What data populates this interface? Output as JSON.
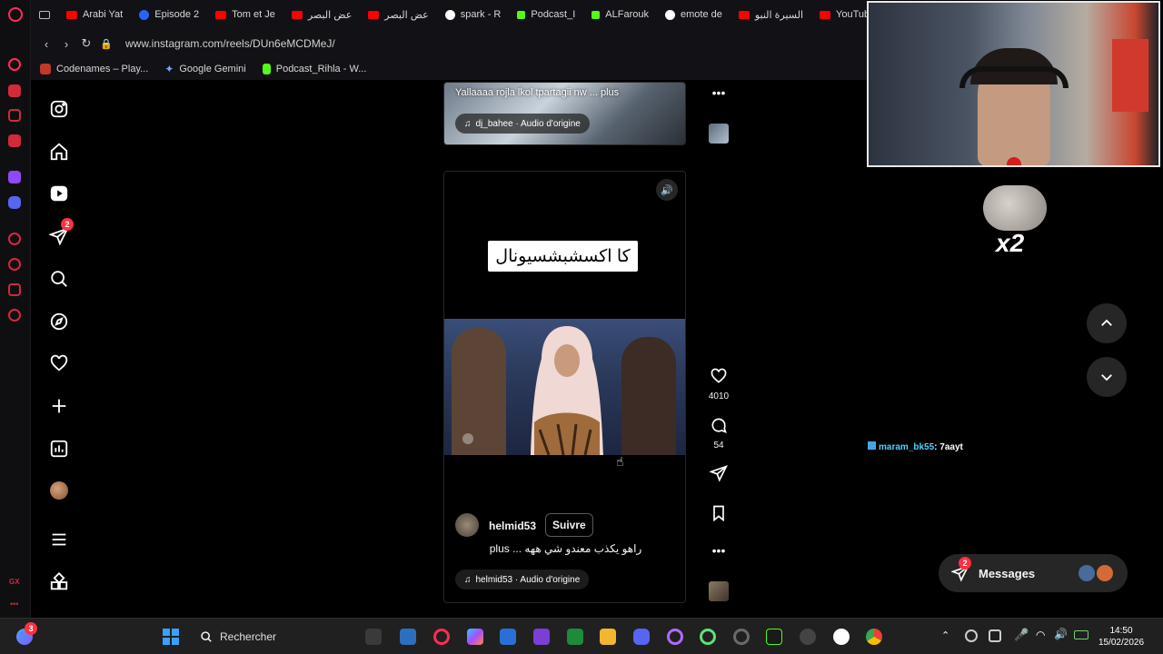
{
  "browser": {
    "tabs": [
      {
        "label": "",
        "color": "#bdbdbd"
      },
      {
        "label": "Arabi Yat",
        "color": "#ff0000"
      },
      {
        "label": "Episode 2",
        "color": "#2962ff"
      },
      {
        "label": "Tom et Je",
        "color": "#ff0000"
      },
      {
        "label": "عض البصر",
        "color": "#ff0000"
      },
      {
        "label": "عض البصر",
        "color": "#ff0000"
      },
      {
        "label": "spark - R",
        "color": "#ffffff"
      },
      {
        "label": "Podcast_I",
        "color": "#53fc18"
      },
      {
        "label": "ALFarouk",
        "color": "#53fc18"
      },
      {
        "label": "emote de",
        "color": "#ffffff"
      },
      {
        "label": "السيرة النبو",
        "color": "#ff0000"
      },
      {
        "label": "YouTube",
        "color": "#ff0000"
      }
    ],
    "url": "www.instagram.com/reels/DUn6eMCDMeJ/",
    "bookmarks": [
      {
        "label": "Codenames – Play...",
        "color": "#c0392b"
      },
      {
        "label": "Google Gemini",
        "color": "#7aa2ff"
      },
      {
        "label": "Podcast_Rihla - W...",
        "color": "#53fc18"
      }
    ]
  },
  "instagram": {
    "nav": {
      "notifications_badge": "2",
      "items": [
        "instagram-logo",
        "home",
        "reels",
        "messages",
        "search",
        "explore",
        "notifications",
        "create",
        "dashboard",
        "profile",
        "more",
        "meta"
      ]
    },
    "reel_top": {
      "caption": "Yallaaaa rojla lkol tpartagii nw ... plus",
      "audio": "dj_bahee · Audio d'origine"
    },
    "reel_main": {
      "overlay_caption": "كا اكسشبشسيونال",
      "username": "helmid53",
      "follow_label": "Suivre",
      "caption": "راهو يكذب معندو شي ههه ... plus",
      "audio": "helmid53 · Audio d'origine",
      "likes": "4010",
      "comments": "54"
    },
    "messages": {
      "label": "Messages",
      "badge": "2"
    }
  },
  "overlay": {
    "emote_text": "x2",
    "chat_user": "maram_bk55",
    "chat_message": ": 7aayt"
  },
  "taskbar": {
    "search_placeholder": "Rechercher",
    "widget_badge": "3",
    "time": "14:50",
    "date": "15/02/2026"
  },
  "colors": {
    "accent_red": "#ff3040",
    "background": "#000000",
    "panel": "#262626"
  }
}
